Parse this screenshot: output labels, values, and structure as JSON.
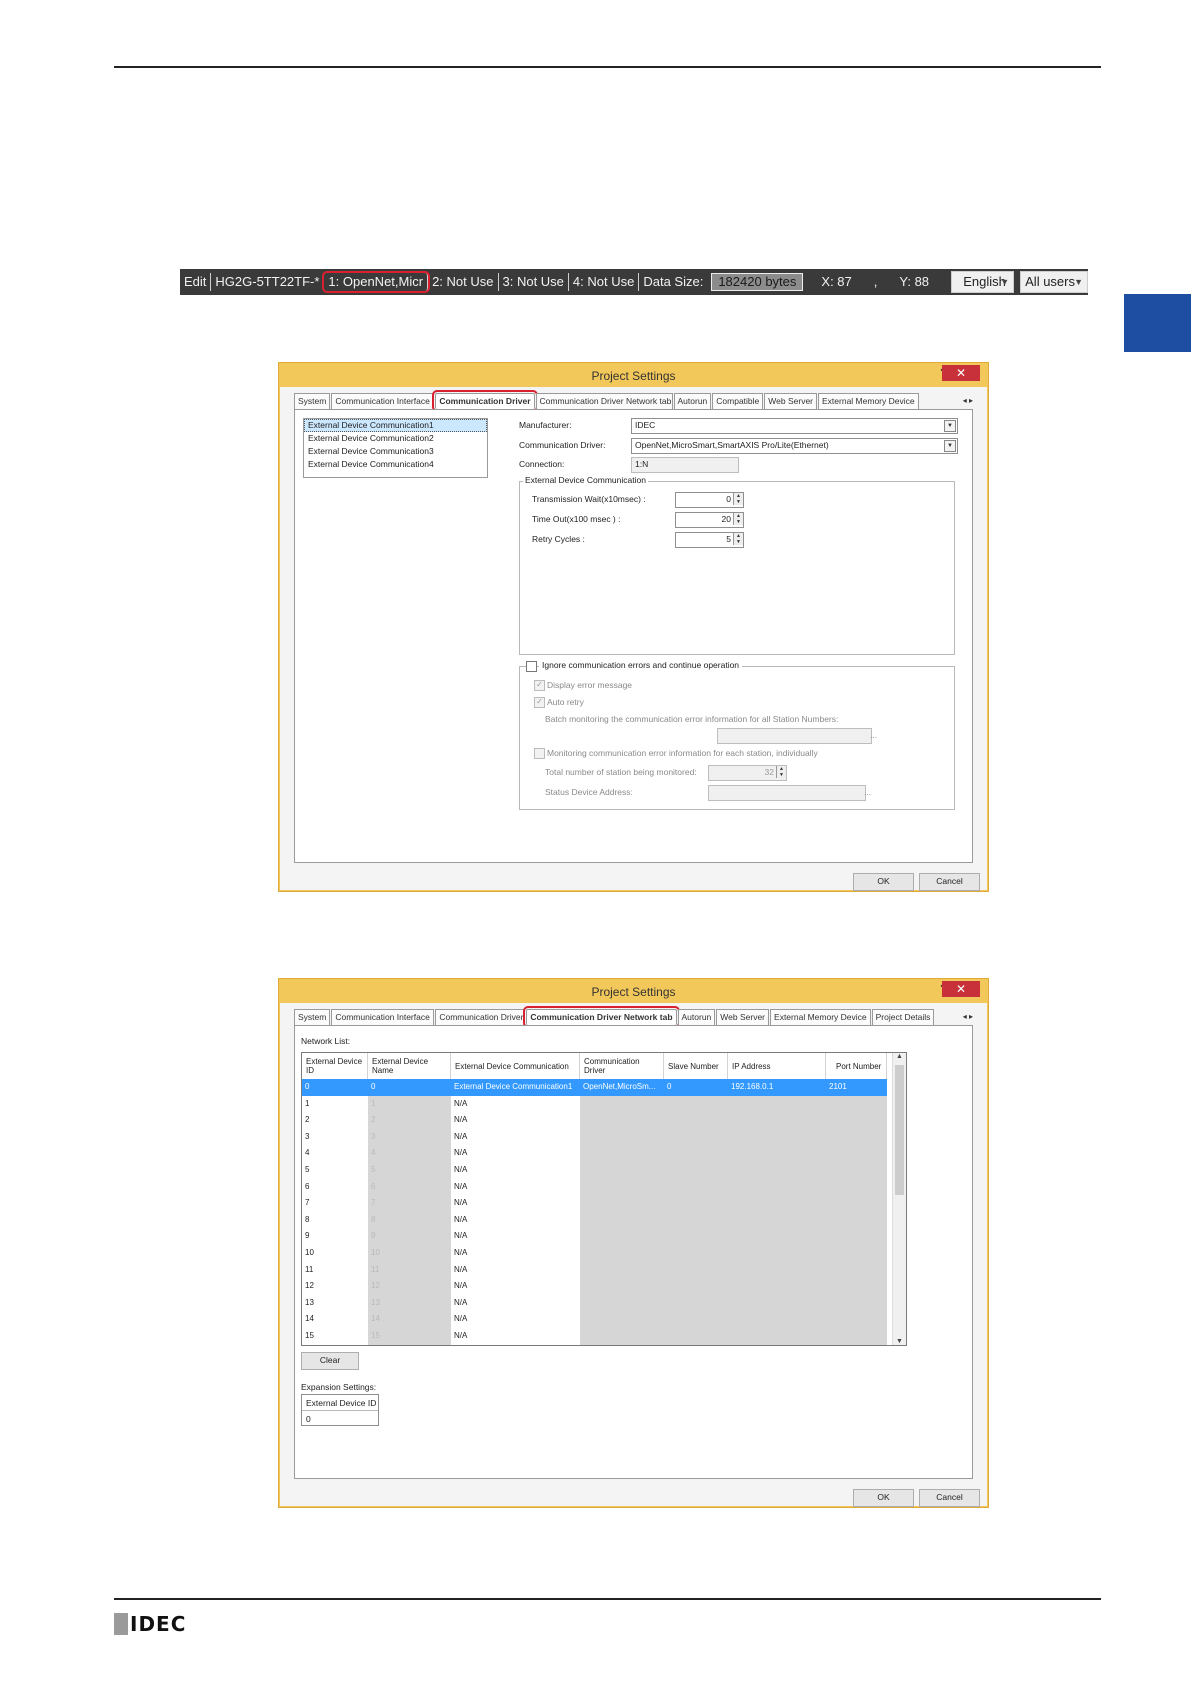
{
  "statusbar": {
    "edit": "Edit",
    "model": "HG2G-5TT22TF-*",
    "comm1": "1: OpenNet,Micr",
    "comm2": "2: Not Use",
    "comm3": "3: Not Use",
    "comm4": "4: Not Use",
    "data_size_label": "Data Size:",
    "data_size_value": "182420 bytes",
    "x": "X: 87",
    "sep": ",",
    "y": "Y: 88",
    "language": "English",
    "users": "All users"
  },
  "dialog1": {
    "title": "Project Settings",
    "help": "?",
    "close": "✕",
    "tabs": [
      "System",
      "Communication Interface",
      "Communication Driver",
      "Communication Driver Network tab",
      "Autorun",
      "Compatible",
      "Web Server",
      "External Memory Device"
    ],
    "tab_arrows": "◂ ▸",
    "list": [
      "External Device Communication1",
      "External Device Communication2",
      "External Device Communication3",
      "External Device Communication4"
    ],
    "manufacturer_label": "Manufacturer:",
    "manufacturer_value": "IDEC",
    "driver_label": "Communication Driver:",
    "driver_value": "OpenNet,MicroSmart,SmartAXIS Pro/Lite(Ethernet)",
    "connection_label": "Connection:",
    "connection_value": "1:N",
    "group_title": "External Device Communication",
    "trans_wait_label": "Transmission Wait(x10msec) :",
    "trans_wait_value": "0",
    "timeout_label": "Time Out(x100 msec ) :",
    "timeout_value": "20",
    "retry_label": "Retry Cycles :",
    "retry_value": "5",
    "ignore_label": "Ignore communication errors and continue operation",
    "display_error_label": "Display error message",
    "auto_retry_label": "Auto retry",
    "batch_label": "Batch monitoring the communication error information for all Station Numbers:",
    "monitoring_label": "Monitoring communication error information for each station, individually",
    "total_label": "Total number of station being monitored:",
    "total_value": "32",
    "status_label": "Status Device Address:",
    "ellipsis": "...",
    "ok": "OK",
    "cancel": "Cancel"
  },
  "dialog2": {
    "title": "Project Settings",
    "help": "?",
    "close": "✕",
    "tabs": [
      "System",
      "Communication Interface",
      "Communication Driver",
      "Communication Driver Network tab",
      "Autorun",
      "Web Server",
      "External Memory Device",
      "Project Details"
    ],
    "tab_arrows": "◂ ▸",
    "network_list_label": "Network List:",
    "columns": [
      "External Device ID",
      "External Device Name",
      "External Device Communication",
      "Communication Driver",
      "Slave Number",
      "IP Address",
      "Port Number"
    ],
    "first_row": {
      "id": "0",
      "name": "0",
      "comm": "External Device Communication1",
      "driver": "OpenNet,MicroSm...",
      "slave": "0",
      "ip": "192.168.0.1",
      "port": "2101"
    },
    "rows": [
      {
        "id": "1",
        "name": "1",
        "comm": "N/A"
      },
      {
        "id": "2",
        "name": "2",
        "comm": "N/A"
      },
      {
        "id": "3",
        "name": "3",
        "comm": "N/A"
      },
      {
        "id": "4",
        "name": "4",
        "comm": "N/A"
      },
      {
        "id": "5",
        "name": "5",
        "comm": "N/A"
      },
      {
        "id": "6",
        "name": "6",
        "comm": "N/A"
      },
      {
        "id": "7",
        "name": "7",
        "comm": "N/A"
      },
      {
        "id": "8",
        "name": "8",
        "comm": "N/A"
      },
      {
        "id": "9",
        "name": "9",
        "comm": "N/A"
      },
      {
        "id": "10",
        "name": "10",
        "comm": "N/A"
      },
      {
        "id": "11",
        "name": "11",
        "comm": "N/A"
      },
      {
        "id": "12",
        "name": "12",
        "comm": "N/A"
      },
      {
        "id": "13",
        "name": "13",
        "comm": "N/A"
      },
      {
        "id": "14",
        "name": "14",
        "comm": "N/A"
      },
      {
        "id": "15",
        "name": "15",
        "comm": "N/A"
      }
    ],
    "clear": "Clear",
    "expansion_label": "Expansion Settings:",
    "expansion_column": "External Device ID",
    "expansion_value": "0",
    "ok": "OK",
    "cancel": "Cancel"
  },
  "footer": {
    "logo": "IDEC"
  },
  "colors": {
    "highlight_red": "#d8202e",
    "dialog_border": "#f3c85a",
    "selection_blue": "#3399ff",
    "side_tab_blue": "#1e4ea1"
  }
}
